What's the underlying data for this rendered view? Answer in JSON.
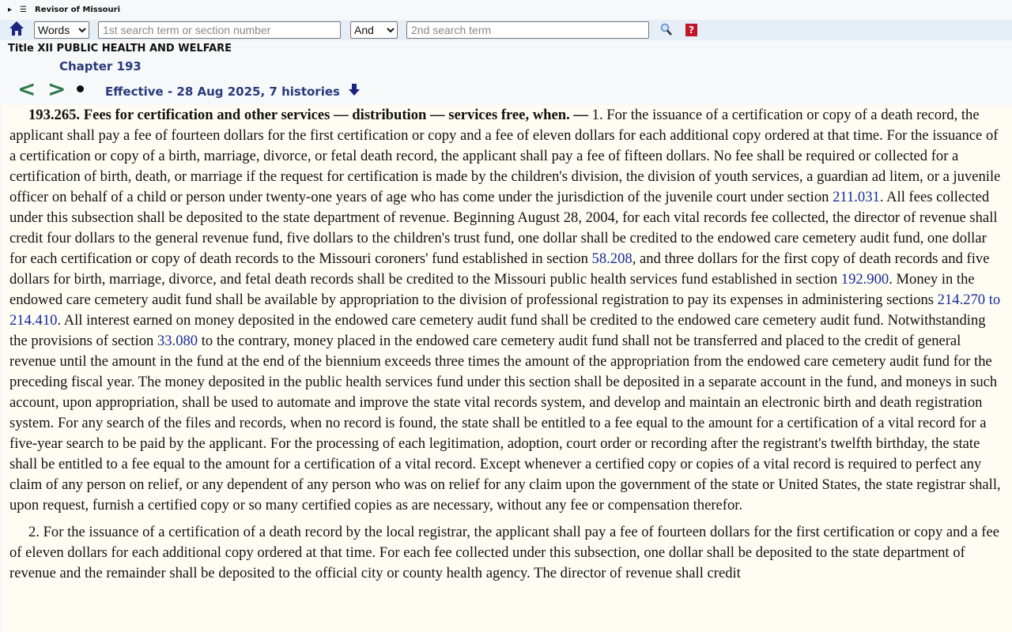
{
  "header": {
    "site_name": "Revisor of Missouri",
    "expand_icon": "triangle-right-icon",
    "menu_icon": "hamburger-icon"
  },
  "search": {
    "mode_select": "Words",
    "term1_placeholder": "1st search term or section number",
    "operator_select": "And",
    "term2_placeholder": "2nd search term",
    "help_label": "?"
  },
  "breadcrumb": {
    "title": "Title XII PUBLIC HEALTH AND WELFARE",
    "chapter": "Chapter 193"
  },
  "nav": {
    "prev": "<",
    "next": ">",
    "effective": "Effective - 28 Aug 2025, 7 histories"
  },
  "section": {
    "heading": "193.265.  Fees for certification and other services — distribution — services free, when. — ",
    "paragraphs": [
      [
        {
          "t": "1.  For the issuance of a certification or copy of a death record, the applicant shall pay a fee of fourteen dollars for the first certification or copy and a fee of eleven dollars for each additional copy ordered at that time.  For the issuance of a certification or copy of a birth, marriage, divorce, or fetal death record, the applicant shall pay a fee of fifteen dollars.  No fee shall be required or collected for a certification of birth, death, or marriage if the request for certification is made by the children's division, the division of youth services, a guardian ad litem, or a juvenile officer on behalf of a child or person under twenty-one years of age who has come under the jurisdiction of the juvenile court under section "
        },
        {
          "link": "211.031"
        },
        {
          "t": ".  All fees collected under this subsection shall be deposited to the state department of revenue.  Beginning August 28, 2004, for each vital records fee collected, the director of revenue shall credit four dollars to the general revenue fund, five dollars to the children's trust fund, one dollar shall be credited to the endowed care cemetery audit fund, one dollar for each certification or copy of death records to the Missouri coroners' fund established in section "
        },
        {
          "link": "58.208"
        },
        {
          "t": ", and three dollars for the first copy of death records and five dollars for birth, marriage, divorce, and fetal death records shall be credited to the Missouri public health services fund established in section "
        },
        {
          "link": "192.900"
        },
        {
          "t": ".  Money in the endowed care cemetery audit fund shall be available by appropriation to the division of professional registration to pay its expenses in administering sections "
        },
        {
          "link": "214.270 to 214.410"
        },
        {
          "t": ".  All interest earned on money deposited in the endowed care cemetery audit fund shall be credited to the endowed care cemetery audit fund.  Notwithstanding the provisions of section "
        },
        {
          "link": "33.080"
        },
        {
          "t": " to the contrary, money placed in the endowed care cemetery audit fund shall not be transferred and placed to the credit of general revenue until the amount in the fund at the end of the biennium exceeds three times the amount of the appropriation from the endowed care cemetery audit fund for the preceding fiscal year.  The money deposited in the public health services fund under this section shall be deposited in a separate account in the fund, and moneys in such account, upon appropriation, shall be used to automate and improve the state vital records system, and develop and maintain an electronic birth and death registration system.  For any search of the files and records, when no record is found, the state shall be entitled to a fee equal to the amount for a certification of a vital record for a five-year search to be paid by the applicant.  For the processing of each legitimation, adoption, court order or recording after the registrant's twelfth birthday, the state shall be entitled to a fee equal to the amount for a certification of a vital record.  Except whenever a certified copy or copies of a vital record is required to perfect any claim of any person on relief, or any dependent of any person who was on relief for any claim upon the government of the state or United States, the state registrar shall, upon request, furnish a certified copy or so many certified copies as are necessary, without any fee or compensation therefor."
        }
      ],
      [
        {
          "t": "2.  For the issuance of a certification of a death record by the local registrar, the applicant shall pay a fee of fourteen dollars for the first certification or copy and a fee of eleven dollars for each additional copy ordered at that time.  For each fee collected under this subsection, one dollar shall be deposited to the state department of revenue and the remainder shall be deposited to the official city or county health agency.  The director of revenue shall credit"
        }
      ]
    ]
  }
}
